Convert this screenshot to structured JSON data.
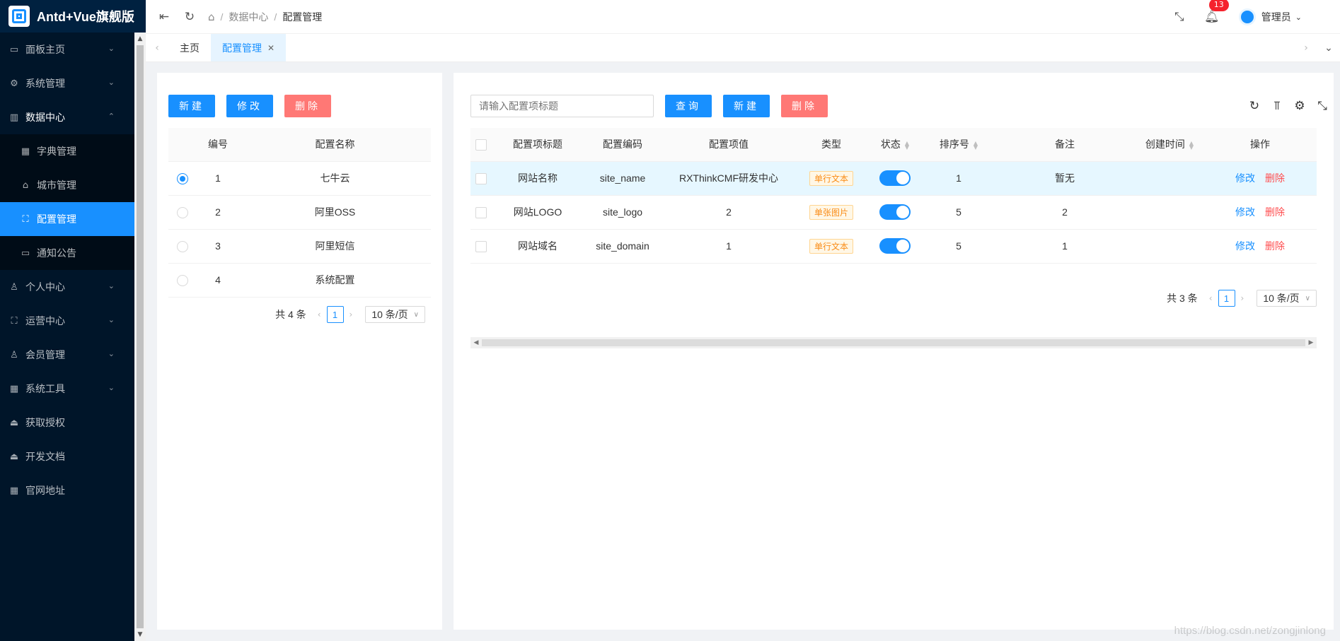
{
  "app_title": "Antd+Vue旗舰版",
  "sidebar": {
    "items": [
      {
        "label": "面板主页",
        "icon": "monitor-icon",
        "glyph": "▭",
        "arrow": "⌄"
      },
      {
        "label": "系统管理",
        "icon": "gear-icon",
        "glyph": "⚙",
        "arrow": "⌄"
      },
      {
        "label": "数据中心",
        "icon": "chart-icon",
        "glyph": "▥",
        "arrow": "⌃"
      },
      {
        "label": "个人中心",
        "icon": "user-icon",
        "glyph": "♙",
        "arrow": "⌄"
      },
      {
        "label": "运营中心",
        "icon": "scan-icon",
        "glyph": "⛶",
        "arrow": "⌄"
      },
      {
        "label": "会员管理",
        "icon": "user-icon",
        "glyph": "♙",
        "arrow": "⌄"
      },
      {
        "label": "系统工具",
        "icon": "appstore-icon",
        "glyph": "▦",
        "arrow": "⌄"
      },
      {
        "label": "获取授权",
        "icon": "bank-icon",
        "glyph": "⏏",
        "arrow": ""
      },
      {
        "label": "开发文档",
        "icon": "bank-icon",
        "glyph": "⏏",
        "arrow": ""
      },
      {
        "label": "官网地址",
        "icon": "appstore-icon",
        "glyph": "▦",
        "arrow": ""
      }
    ],
    "submenu": [
      {
        "label": "字典管理",
        "icon": "appstore-icon",
        "glyph": "▦"
      },
      {
        "label": "城市管理",
        "icon": "bank-icon",
        "glyph": "⌂"
      },
      {
        "label": "配置管理",
        "icon": "scan-icon",
        "glyph": "⛶"
      },
      {
        "label": "通知公告",
        "icon": "notice-icon",
        "glyph": "▭"
      }
    ]
  },
  "header": {
    "breadcrumb": [
      "数据中心",
      "配置管理"
    ],
    "notification_count": "13",
    "user": "管理员"
  },
  "tabs": [
    {
      "label": "主页"
    },
    {
      "label": "配置管理",
      "close": "✕"
    }
  ],
  "left_panel": {
    "buttons": {
      "new": "新建",
      "edit": "修改",
      "delete": "删除"
    },
    "columns": [
      "编号",
      "配置名称"
    ],
    "rows": [
      {
        "id": "1",
        "name": "七牛云",
        "selected": true
      },
      {
        "id": "2",
        "name": "阿里OSS",
        "selected": false
      },
      {
        "id": "3",
        "name": "阿里短信",
        "selected": false
      },
      {
        "id": "4",
        "name": "系统配置",
        "selected": false
      }
    ],
    "pagination": {
      "total": "共 4 条",
      "page": "1",
      "size": "10 条/页"
    }
  },
  "right_panel": {
    "search_placeholder": "请输入配置项标题",
    "buttons": {
      "query": "查询",
      "new": "新建",
      "delete": "删除"
    },
    "columns": [
      "配置项标题",
      "配置编码",
      "配置项值",
      "类型",
      "状态",
      "排序号",
      "备注",
      "创建时间",
      "操作"
    ],
    "rows": [
      {
        "title": "网站名称",
        "code": "site_name",
        "value": "RXThinkCMF研发中心",
        "type": "单行文本",
        "status": true,
        "sort": "1",
        "note": "暂无",
        "created": "",
        "edit": "修改",
        "del": "删除"
      },
      {
        "title": "网站LOGO",
        "code": "site_logo",
        "value": "2",
        "type": "单张图片",
        "status": true,
        "sort": "5",
        "note": "2",
        "created": "",
        "edit": "修改",
        "del": "删除"
      },
      {
        "title": "网站域名",
        "code": "site_domain",
        "value": "1",
        "type": "单行文本",
        "status": true,
        "sort": "5",
        "note": "1",
        "created": "",
        "edit": "修改",
        "del": "删除"
      }
    ],
    "pagination": {
      "total": "共 3 条",
      "page": "1",
      "size": "10 条/页"
    }
  },
  "watermark": "https://blog.csdn.net/zongjinlong",
  "colors": {
    "primary": "#1890ff",
    "danger": "#ff7875",
    "sidebar": "#001529"
  }
}
